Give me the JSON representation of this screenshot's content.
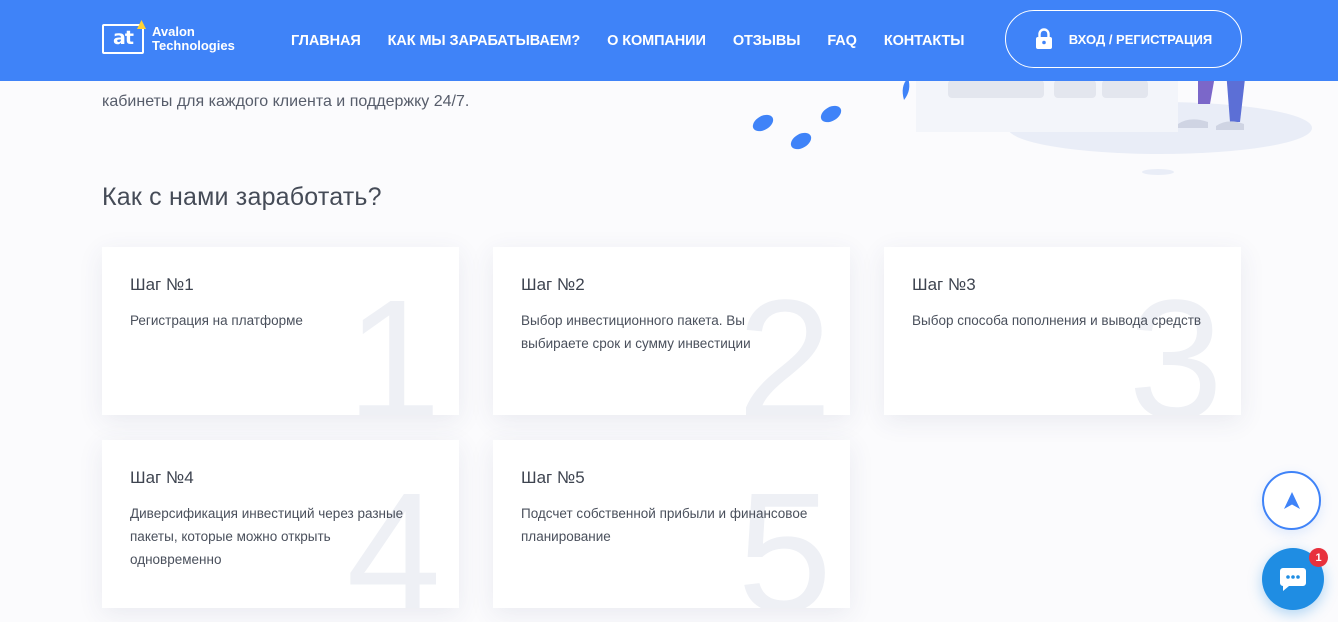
{
  "header": {
    "logo_line1": "Avalon",
    "logo_line2": "Technologies",
    "logo_mark": "at",
    "nav": [
      {
        "label": "ГЛАВНАЯ"
      },
      {
        "label": "КАК МЫ ЗАРАБАТЫВАЕМ?"
      },
      {
        "label": "О КОМПАНИИ"
      },
      {
        "label": "ОТЗЫВЫ"
      },
      {
        "label": "FAQ"
      },
      {
        "label": "КОНТАКТЫ"
      }
    ],
    "login_label": "ВХОД / РЕГИСТРАЦИЯ",
    "login_icon": "lock-icon"
  },
  "intro": {
    "text": "кабинеты для каждого клиента и поддержку 24/7."
  },
  "steps_section": {
    "title": "Как с нами заработать?",
    "steps": [
      {
        "number": "1",
        "title": "Шаг №1",
        "description": "Регистрация на платформе"
      },
      {
        "number": "2",
        "title": "Шаг №2",
        "description": "Выбор инвестиционного пакета. Вы выбираете срок и сумму инвестиции"
      },
      {
        "number": "3",
        "title": "Шаг №3",
        "description": "Выбор способа пополнения и вывода средств"
      },
      {
        "number": "4",
        "title": "Шаг №4",
        "description": "Диверсификация инвестиций через разные пакеты, которые можно открыть одновременно"
      },
      {
        "number": "5",
        "title": "Шаг №5",
        "description": "Подсчет собственной прибыли и финансовое планирование"
      }
    ]
  },
  "floating": {
    "scroll_top_icon": "arrow-up-icon",
    "chat_icon": "chat-bubble-icon",
    "chat_badge": "1"
  },
  "colors": {
    "header_bg": "#3f83f8",
    "accent": "#3f83f8",
    "chat_bg": "#1f8de3",
    "badge_bg": "#e8313d"
  }
}
